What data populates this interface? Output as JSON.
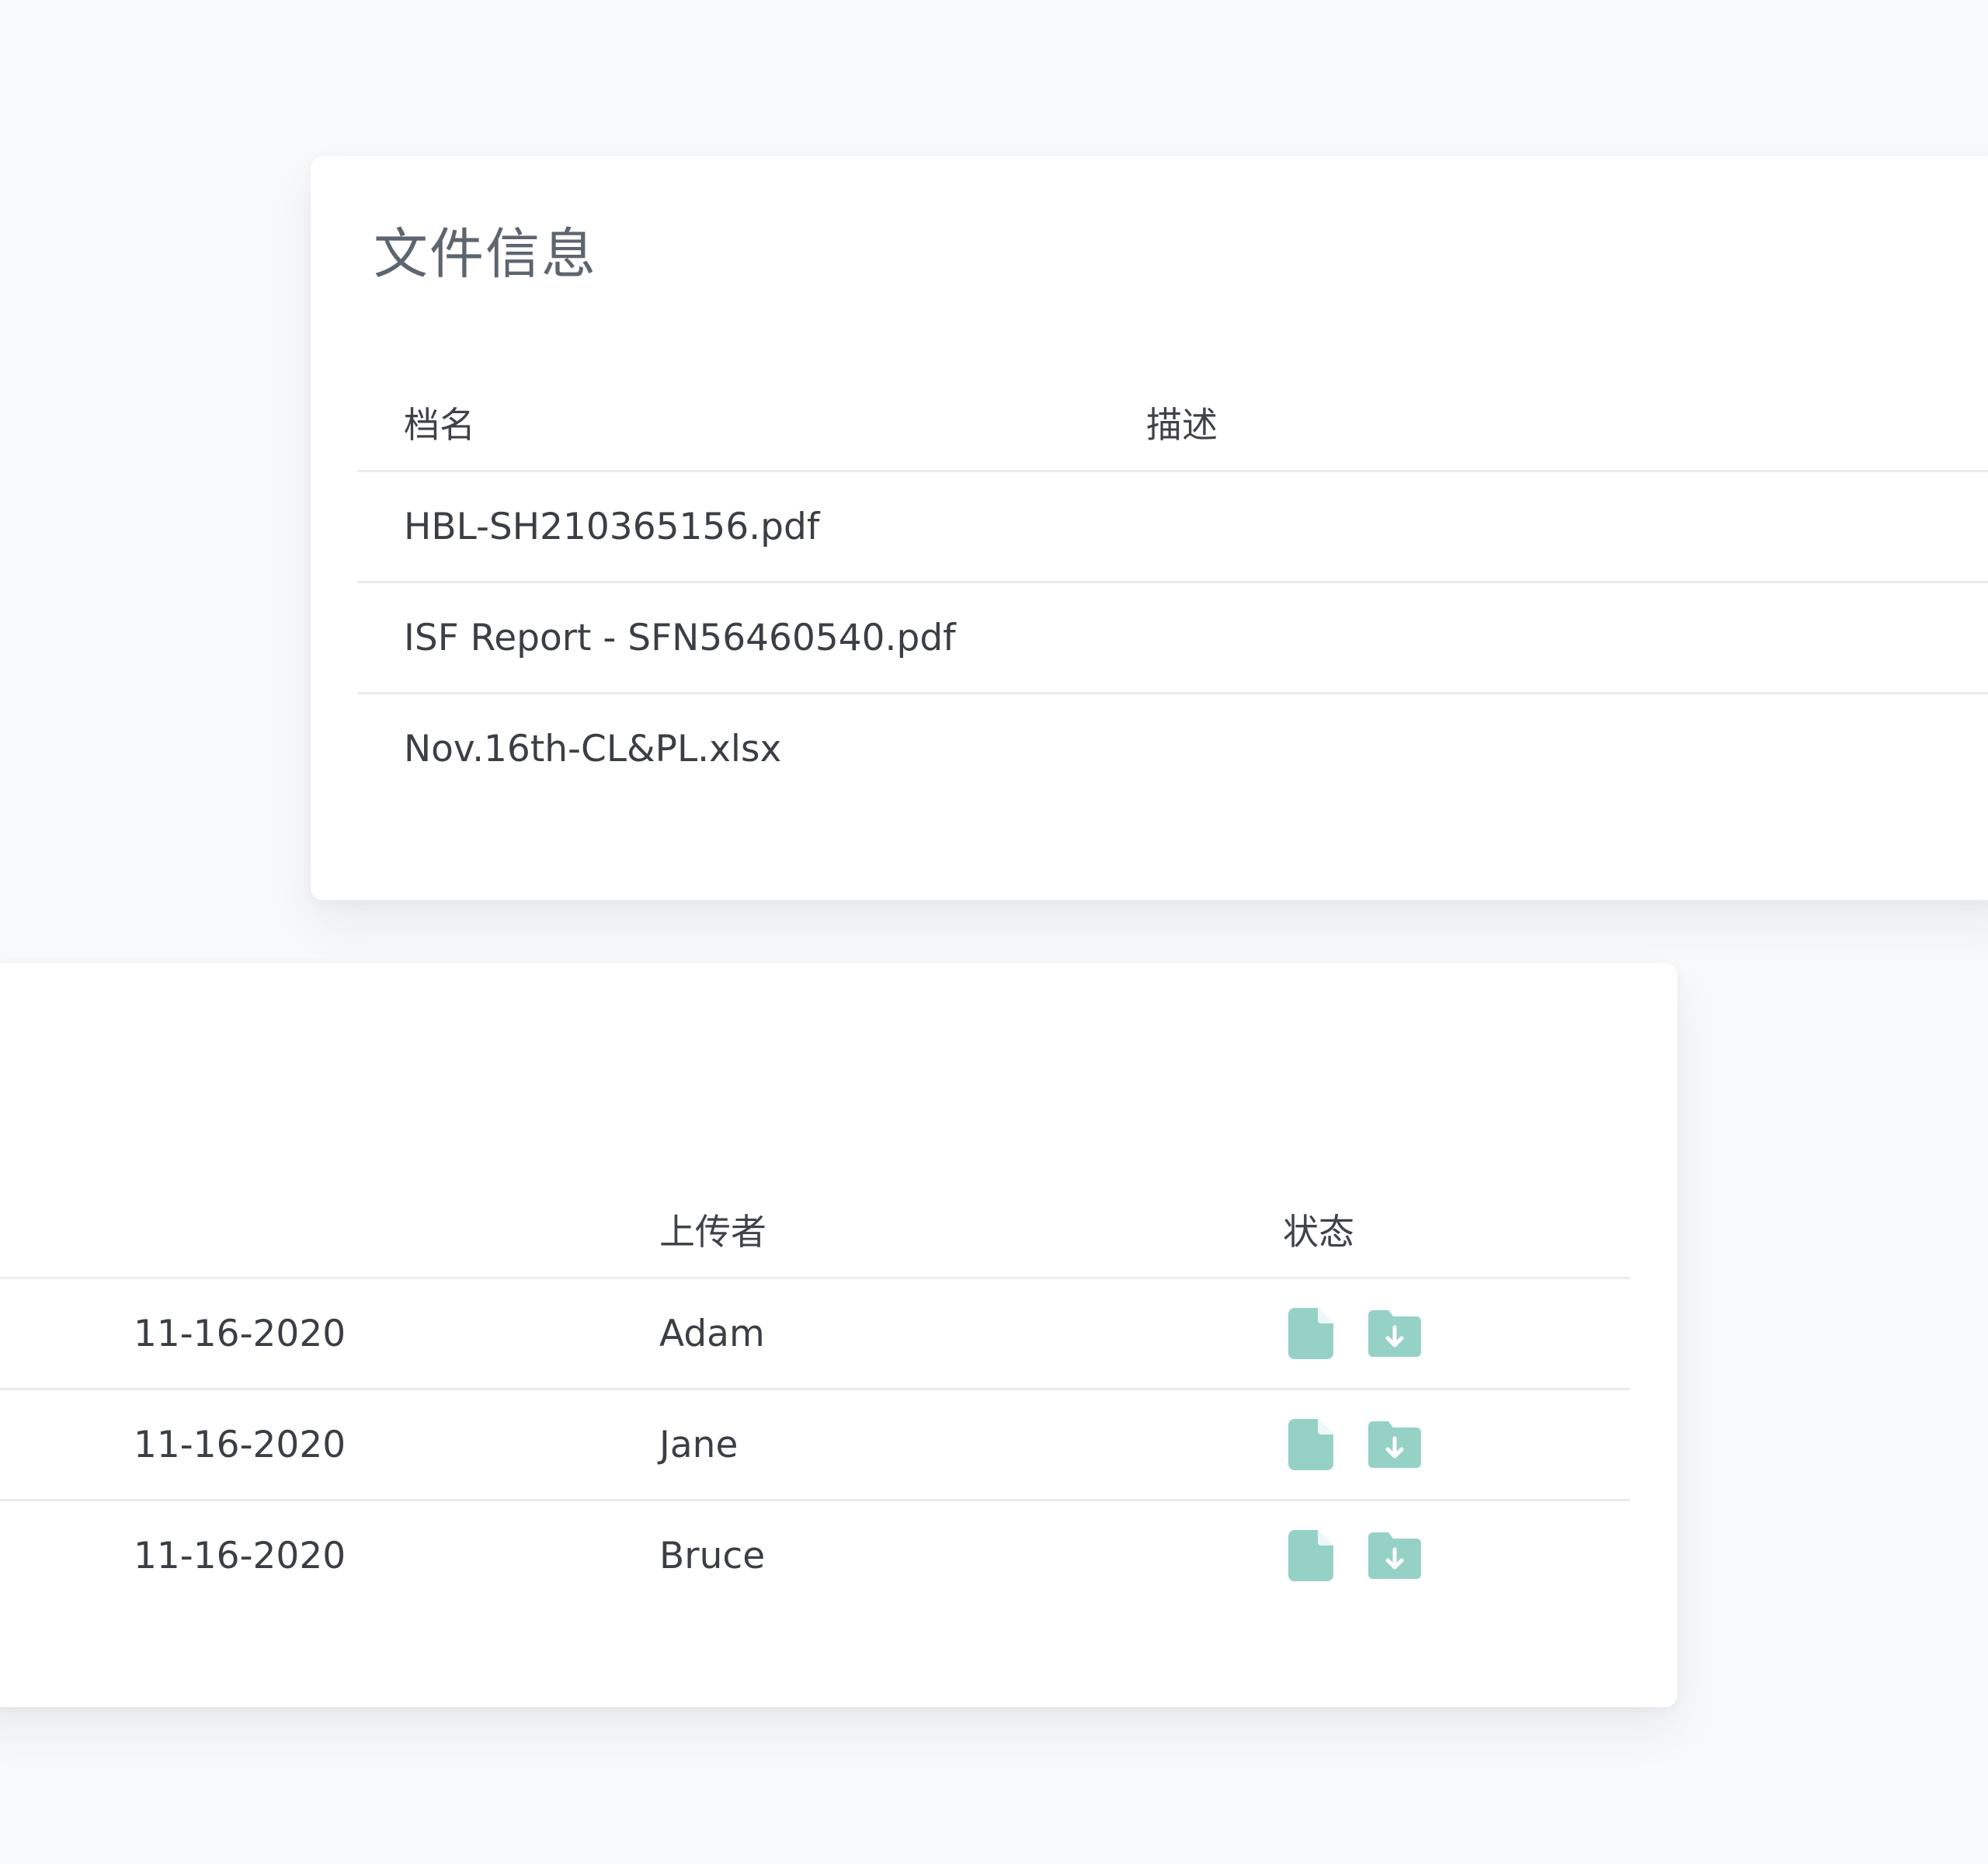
{
  "files_card": {
    "title": "文件信息",
    "columns": {
      "name": "档名",
      "description": "描述"
    },
    "rows": [
      {
        "name": "HBL-SH210365156.pdf",
        "description": ""
      },
      {
        "name": "ISF Report - SFN56460540.pdf",
        "description": ""
      },
      {
        "name": "Nov.16th-CL&PL.xlsx",
        "description": ""
      }
    ]
  },
  "uploads_card": {
    "columns": {
      "date": "",
      "uploader": "上传者",
      "status": "状态"
    },
    "rows": [
      {
        "date": "11-16-2020",
        "uploader": "Adam",
        "status_icons": [
          "file-icon",
          "folder-download-icon"
        ]
      },
      {
        "date": "11-16-2020",
        "uploader": "Jane",
        "status_icons": [
          "file-icon",
          "folder-download-icon"
        ]
      },
      {
        "date": "11-16-2020",
        "uploader": "Bruce",
        "status_icons": [
          "file-icon",
          "folder-download-icon"
        ]
      }
    ]
  },
  "colors": {
    "background": "#f8f9fa",
    "card": "#ffffff",
    "icon_teal": "#96d1c5",
    "divider": "#e9ecef",
    "title_gray": "#5d656e"
  }
}
